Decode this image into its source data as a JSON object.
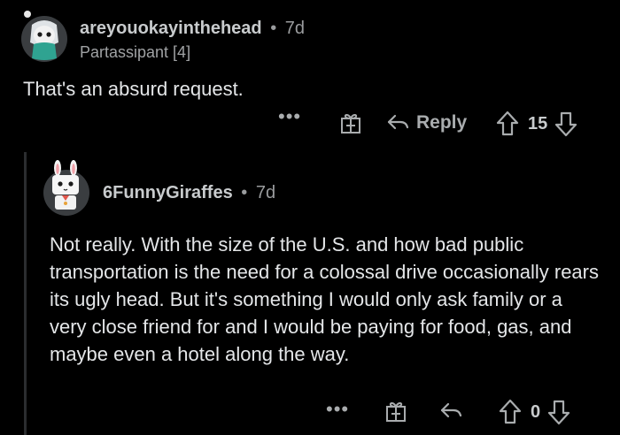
{
  "comment_parent": {
    "username": "areyouokayinthehead",
    "separator": "•",
    "age": "7d",
    "flair": "Partassipant [4]",
    "body": "That's an absurd request.",
    "more_label": "•••",
    "reply_label": "Reply",
    "vote_count": "15"
  },
  "comment_reply": {
    "username": "6FunnyGiraffes",
    "separator": "•",
    "age": "7d",
    "body": "Not really. With the size of the U.S. and how bad public transportation is the need for a colossal drive occasionally rears its ugly head. But it's something I would only ask family or a very close friend for and I would be paying for food, gas, and maybe even a hotel along the way.",
    "more_label": "•••",
    "vote_count": "0"
  },
  "colors": {
    "background": "#000000",
    "text": "#e4e6e8",
    "meta": "#9a9c9e",
    "icon": "#a9acae",
    "thread_line": "#2b2d2f"
  },
  "icons": [
    "avatar-snoo-gray",
    "avatar-snoo-bunny",
    "more-options-icon",
    "award-gift-icon",
    "reply-arrow-icon",
    "upvote-arrow-icon",
    "downvote-arrow-icon"
  ]
}
